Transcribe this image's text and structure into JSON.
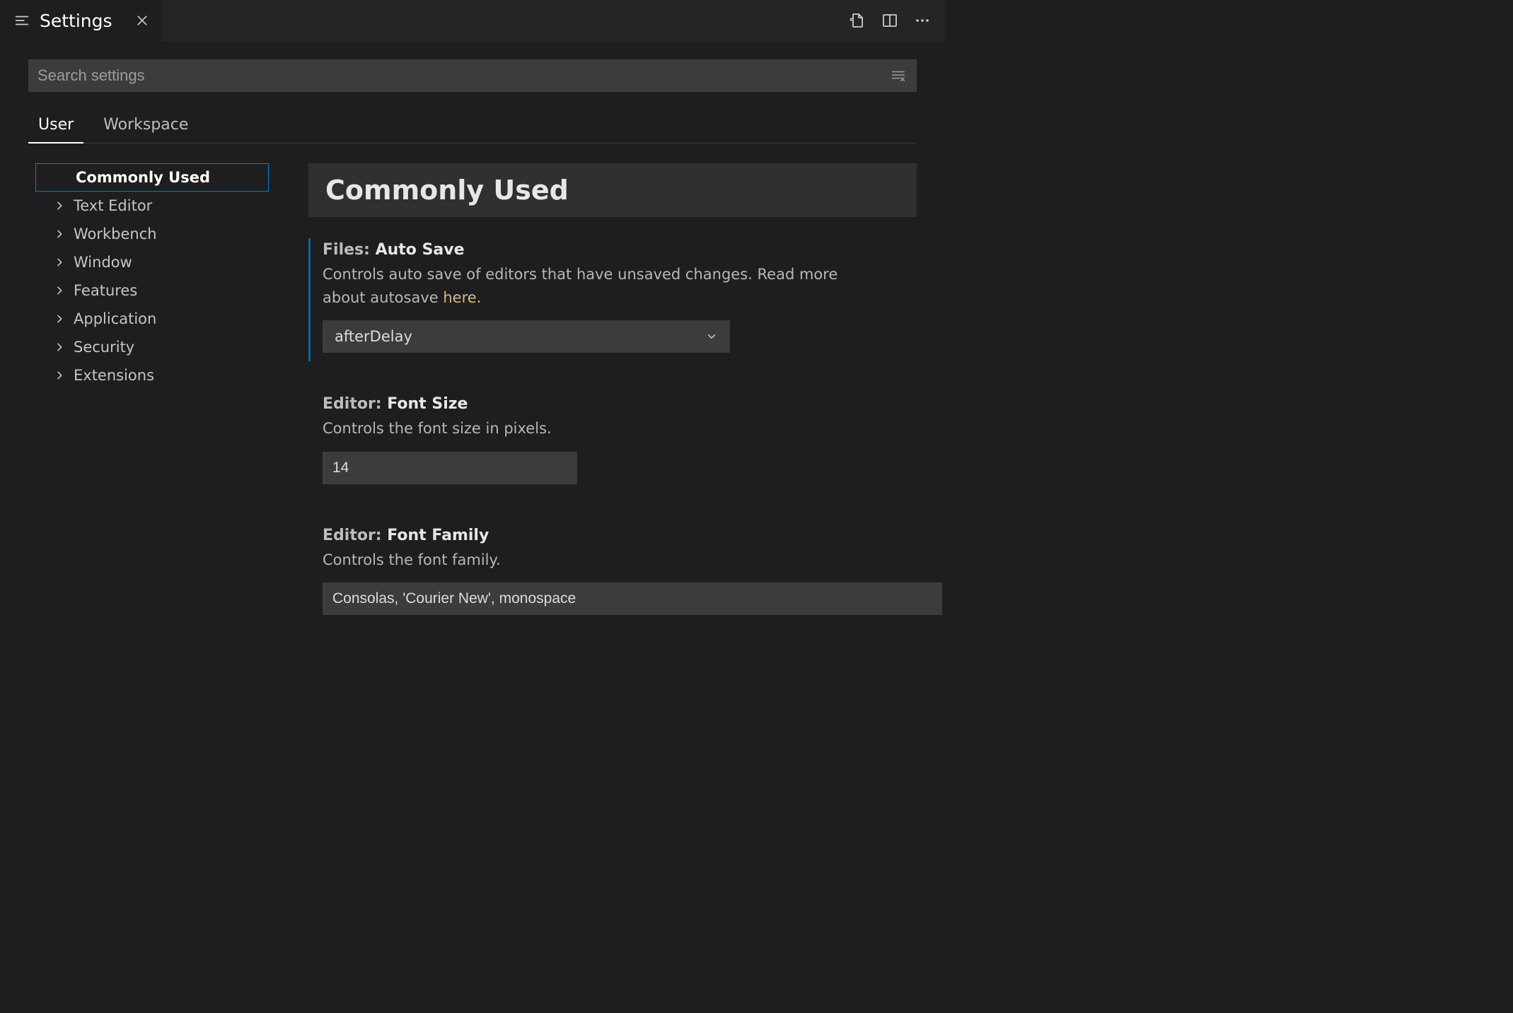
{
  "tab": {
    "title": "Settings"
  },
  "search": {
    "placeholder": "Search settings"
  },
  "scopeTabs": {
    "user": "User",
    "workspace": "Workspace"
  },
  "toc": {
    "items": [
      {
        "label": "Commonly Used"
      },
      {
        "label": "Text Editor"
      },
      {
        "label": "Workbench"
      },
      {
        "label": "Window"
      },
      {
        "label": "Features"
      },
      {
        "label": "Application"
      },
      {
        "label": "Security"
      },
      {
        "label": "Extensions"
      }
    ]
  },
  "section": {
    "title": "Commonly Used"
  },
  "settings": {
    "autoSave": {
      "category": "Files: ",
      "name": "Auto Save",
      "descPre": "Controls auto save of editors that have unsaved changes. Read more about autosave ",
      "descLink": "here",
      "descPost": ".",
      "value": "afterDelay"
    },
    "fontSize": {
      "category": "Editor: ",
      "name": "Font Size",
      "desc": "Controls the font size in pixels.",
      "value": "14"
    },
    "fontFamily": {
      "category": "Editor: ",
      "name": "Font Family",
      "desc": "Controls the font family.",
      "value": "Consolas, 'Courier New', monospace"
    }
  }
}
